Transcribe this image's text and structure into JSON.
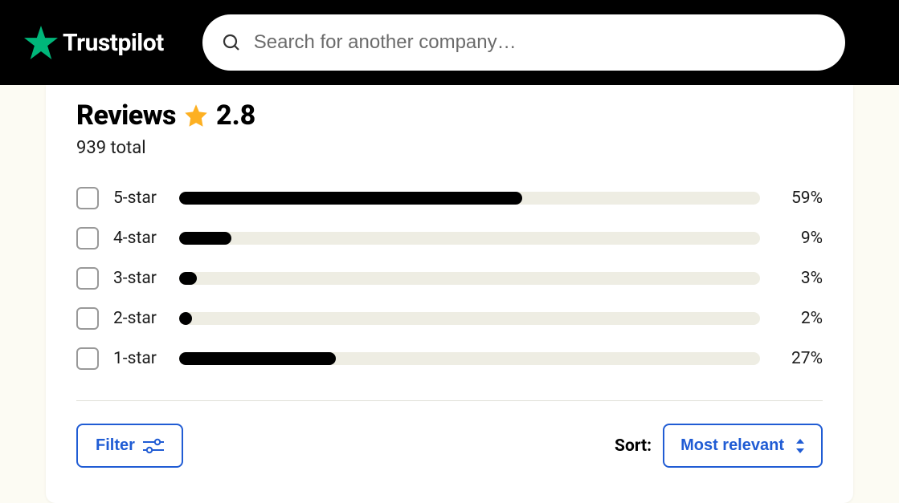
{
  "brand": {
    "name": "Trustpilot",
    "star_color": "#00b67a"
  },
  "search": {
    "placeholder": "Search for another company…"
  },
  "reviews": {
    "title": "Reviews",
    "rating": "2.8",
    "total_text": "939 total",
    "star_icon_color": "#fdb022",
    "rows": [
      {
        "label": "5-star",
        "percent": 59,
        "percent_text": "59%"
      },
      {
        "label": "4-star",
        "percent": 9,
        "percent_text": "9%"
      },
      {
        "label": "3-star",
        "percent": 3,
        "percent_text": "3%"
      },
      {
        "label": "2-star",
        "percent": 2,
        "percent_text": "2%"
      },
      {
        "label": "1-star",
        "percent": 27,
        "percent_text": "27%"
      }
    ]
  },
  "controls": {
    "filter_label": "Filter",
    "sort_label": "Sort:",
    "sort_value": "Most relevant",
    "accent_color": "#205cd4"
  },
  "chart_data": {
    "type": "bar",
    "title": "Reviews 2.8",
    "categories": [
      "5-star",
      "4-star",
      "3-star",
      "2-star",
      "1-star"
    ],
    "values": [
      59,
      9,
      3,
      2,
      27
    ],
    "xlabel": "",
    "ylabel": "Percent",
    "ylim": [
      0,
      100
    ]
  }
}
